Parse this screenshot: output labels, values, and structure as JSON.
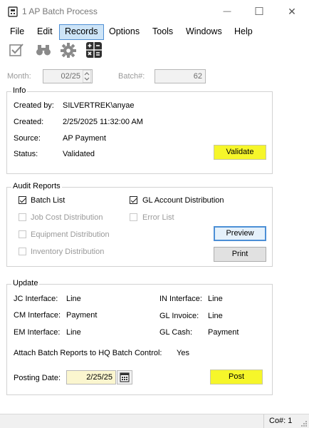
{
  "window": {
    "title": "1 AP Batch Process",
    "minimize_glyph": "—",
    "maximize_glyph": "☐",
    "close_glyph": "✕"
  },
  "menu": {
    "items": [
      "File",
      "Edit",
      "Records",
      "Options",
      "Tools",
      "Windows",
      "Help"
    ],
    "selected": "Records"
  },
  "toolbar": {
    "icons": [
      "checklist-icon",
      "binoculars-icon",
      "gear-icon",
      "calculator-icon"
    ]
  },
  "header": {
    "month_label": "Month:",
    "month_value": "02/25",
    "batch_label": "Batch#:",
    "batch_value": "62"
  },
  "info": {
    "title": "Info",
    "created_by_label": "Created by:",
    "created_by_value": "SILVERTREK\\anyae",
    "created_label": "Created:",
    "created_value": "2/25/2025 11:32:00 AM",
    "source_label": "Source:",
    "source_value": "AP Payment",
    "status_label": "Status:",
    "status_value": "Validated",
    "validate_button": "Validate"
  },
  "audit": {
    "title": "Audit Reports",
    "batch_list": "Batch List",
    "gl_account_distribution": "GL Account Distribution",
    "job_cost_distribution": "Job Cost Distribution",
    "error_list": "Error List",
    "equipment_distribution": "Equipment Distribution",
    "inventory_distribution": "Inventory Distribution",
    "preview_button": "Preview",
    "print_button": "Print",
    "checked": {
      "batch_list": true,
      "gl_account_distribution": true,
      "job_cost_distribution": false,
      "error_list": false,
      "equipment_distribution": false,
      "inventory_distribution": false
    }
  },
  "update": {
    "title": "Update",
    "jc_label": "JC Interface:",
    "jc_value": "Line",
    "in_label": "IN Interface:",
    "in_value": "Line",
    "cm_label": "CM Interface:",
    "cm_value": "Payment",
    "gl_invoice_label": "GL Invoice:",
    "gl_invoice_value": "Line",
    "em_label": "EM Interface:",
    "em_value": "Line",
    "gl_cash_label": "GL Cash:",
    "gl_cash_value": "Payment",
    "attach_label": "Attach Batch Reports to HQ Batch Control:",
    "attach_value": "Yes",
    "posting_date_label": "Posting Date:",
    "posting_date_value": "2/25/25",
    "post_button": "Post"
  },
  "status_bar": {
    "company": "Co#: 1"
  },
  "colors": {
    "highlight": "#f6f62a",
    "menu_selected": "#cde4f7",
    "focus_border": "#4c8fd6"
  }
}
